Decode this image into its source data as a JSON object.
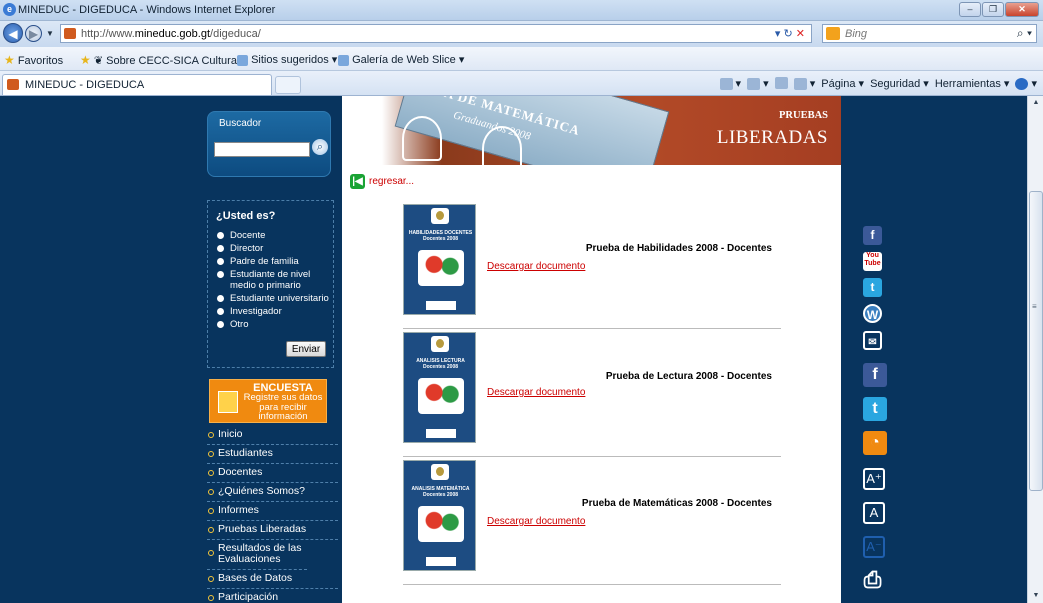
{
  "window": {
    "title": "MINEDUC - DIGEDUCA - Windows Internet Explorer"
  },
  "addressbar": {
    "url_prefix": "http://www.",
    "url_domain": "mineduc.gob.gt",
    "url_path": "/digeduca/",
    "search_placeholder": "Bing"
  },
  "favorites": {
    "label": "Favoritos",
    "items": [
      "Sobre CECC-SICA Cultura...",
      "Sitios sugeridos ▾",
      "Galería de Web Slice ▾"
    ]
  },
  "tab": {
    "title": "MINEDUC - DIGEDUCA"
  },
  "commandbar": {
    "pagina": "Página ▾",
    "seguridad": "Seguridad ▾",
    "herramientas": "Herramientas ▾"
  },
  "sidebar": {
    "search_label": "Buscador",
    "usted_heading": "¿Usted es?",
    "options": [
      "Docente",
      "Director",
      "Padre de familia",
      "Estudiante de nivel medio o primario",
      "Estudiante universitario",
      "Investigador",
      "Otro"
    ],
    "submit_label": "Enviar",
    "encuesta_title": "ENCUESTA",
    "encuesta_text": "Registre sus datos para recibir información",
    "menu": [
      "Inicio",
      "Estudiantes",
      "Docentes",
      "¿Quiénes Somos?",
      "Informes",
      "Pruebas Liberadas",
      "Resultados de las Evaluaciones",
      "Bases de Datos",
      "Participación Internacional"
    ]
  },
  "banner": {
    "poster_title": "A DE MATEMÁTICA",
    "poster_sub": "Graduandos 2008",
    "label_small": "PRUEBAS",
    "label_big": "LIBERADAS"
  },
  "regresar": "regresar...",
  "documents": [
    {
      "cover": "HABILIDADES DOCENTES Docentes 2008",
      "title": "Prueba de Habilidades 2008 - Docentes",
      "link": "Descargar documento"
    },
    {
      "cover": "ANALISIS LECTURA Docentes 2008",
      "title": "Prueba de Lectura 2008 - Docentes",
      "link": "Descargar documento"
    },
    {
      "cover": "ANALISIS MATEMÁTICA Docentes 2008",
      "title": "Prueba de Matemáticas 2008 - Docentes",
      "link": "Descargar documento"
    }
  ],
  "social_icons": [
    "facebook-icon",
    "youtube-icon",
    "twitter-icon",
    "wordpress-icon",
    "mail-icon",
    "facebook-icon",
    "twitter-icon",
    "rss-icon",
    "font-increase-icon",
    "font-normal-icon",
    "font-decrease-icon",
    "print-icon"
  ],
  "colors": {
    "page_bg": "#08345e",
    "link_red": "#cc0000",
    "banner_red": "#b24a27",
    "encuesta_orange": "#f08a10"
  }
}
